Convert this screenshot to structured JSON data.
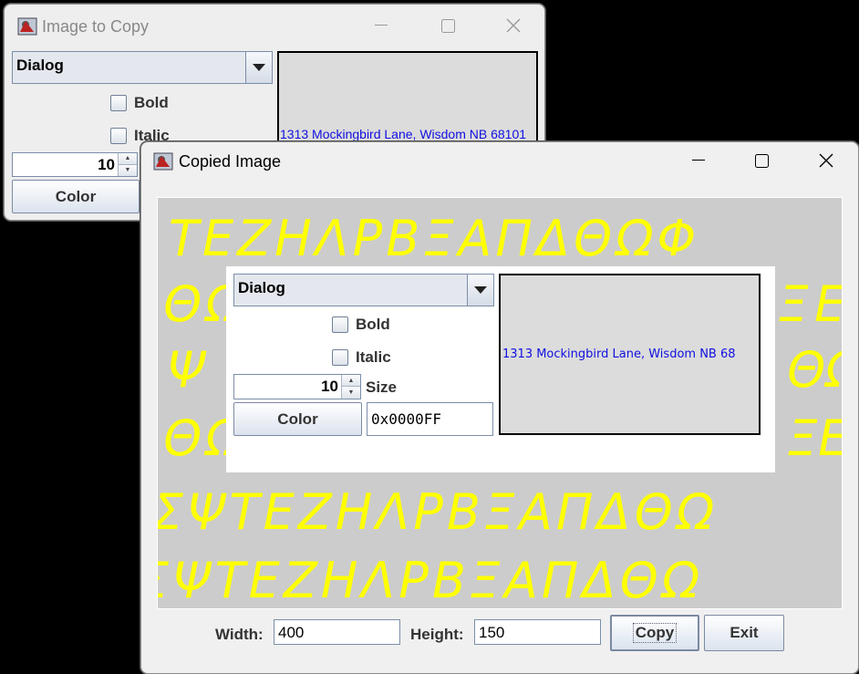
{
  "back_window": {
    "title": "Image to Copy",
    "font_combo": "Dialog",
    "bold_label": "Bold",
    "italic_label": "Italic",
    "size_value": "10",
    "color_button": "Color",
    "preview_text": "1313 Mockingbird Lane, Wisdom NB 68101"
  },
  "front_window": {
    "title": "Copied Image",
    "copied": {
      "font_combo": "Dialog",
      "bold_label": "Bold",
      "italic_label": "Italic",
      "size_value": "10",
      "size_label": "Size",
      "color_button": "Color",
      "color_value": "0x0000FF",
      "preview_text": "1313 Mockingbird Lane, Wisdom NB 68"
    },
    "background_rows": [
      "ΤΕΖΗΛΡΒΞΑΠΔΘΩΦ",
      "ΘΩ",
      "Ψ",
      "ΘΩ",
      "ΞΕ",
      "ΞΕ",
      "ΘΩ",
      "ΞΕ",
      "ΣΨΤΕΖΗΛΡΒΞΑΠΔΘΩ",
      "ΣΨΤΕΖΗΛΡΒΞΑΠΔΘΩ"
    ],
    "width_label": "Width:",
    "width_value": "400",
    "height_label": "Height:",
    "height_value": "150",
    "copy_button": "Copy",
    "exit_button": "Exit"
  },
  "colors": {
    "glyph": "#ffff00",
    "canvas_bg": "#cccccc",
    "preview_text": "#0000ff"
  }
}
